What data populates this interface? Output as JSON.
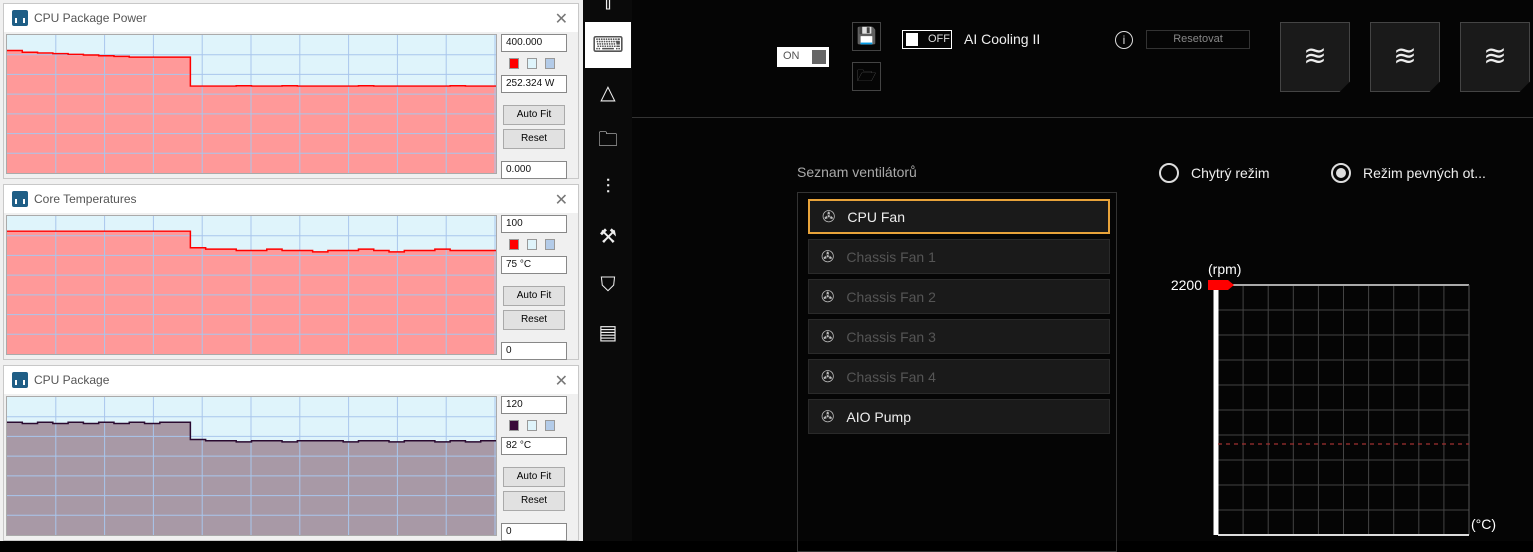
{
  "monitors": [
    {
      "title": "CPU Package Power",
      "max": "400.000",
      "current": "252.324 W",
      "min": "0.000",
      "auto_fit": "Auto Fit",
      "reset": "Reset",
      "line_color": "#ff0000",
      "fill_color": "#ff9999",
      "swatch": "#ff0000",
      "scale_max": 400,
      "values": [
        355,
        350,
        348,
        346,
        344,
        342,
        340,
        338,
        336,
        336,
        336,
        336,
        252,
        252,
        252,
        253,
        252,
        252,
        253,
        252,
        252,
        252,
        252,
        253,
        252,
        252,
        252,
        252,
        252,
        253,
        252,
        252
      ]
    },
    {
      "title": "Core Temperatures",
      "max": "100",
      "current": "75 °C",
      "min": "0",
      "auto_fit": "Auto Fit",
      "reset": "Reset",
      "line_color": "#ff0000",
      "fill_color": "#ff9999",
      "swatch": "#ff0000",
      "scale_max": 100,
      "values": [
        89,
        89,
        89,
        89,
        89,
        89,
        89,
        89,
        89,
        89,
        89,
        89,
        77,
        76,
        76,
        75,
        75,
        76,
        75,
        75,
        74,
        75,
        75,
        76,
        75,
        74,
        75,
        75,
        76,
        75,
        75,
        75
      ]
    },
    {
      "title": "CPU Package",
      "max": "120",
      "current": "82 °C",
      "min": "0",
      "auto_fit": "Auto Fit",
      "reset": "Reset",
      "line_color": "#2a0a30",
      "fill_color": "#a899a6",
      "swatch": "#3a0a3a",
      "scale_max": 120,
      "values": [
        98,
        97,
        98,
        97,
        98,
        97,
        98,
        97,
        98,
        97,
        98,
        98,
        83,
        82,
        82,
        81,
        82,
        82,
        81,
        82,
        82,
        82,
        81,
        82,
        82,
        81,
        82,
        82,
        81,
        82,
        81,
        82
      ]
    }
  ],
  "sidebar": {
    "items": [
      "keyboard-mouse-icon",
      "aura-icon",
      "game-folder-icon",
      "equalizer-icon",
      "tools-icon",
      "tag-icon",
      "news-icon"
    ]
  },
  "top": {
    "on_label": "ON",
    "off_label": "OFF",
    "ai_cooling": "AI Cooling II",
    "reset_label": "Resetovat"
  },
  "fan_list": {
    "title": "Seznam ventilátorů",
    "items": [
      {
        "label": "CPU Fan",
        "selected": true,
        "enabled": true
      },
      {
        "label": "Chassis Fan 1",
        "enabled": false
      },
      {
        "label": "Chassis Fan 2",
        "enabled": false
      },
      {
        "label": "Chassis Fan 3",
        "enabled": false
      },
      {
        "label": "Chassis Fan 4",
        "enabled": false
      },
      {
        "label": "AIO Pump",
        "enabled": true
      }
    ]
  },
  "modes": {
    "smart": "Chytrý režim",
    "fixed": "Režim pevných ot...",
    "selected": "fixed"
  },
  "chart_data": {
    "type": "line",
    "ylabel": "(rpm)",
    "xlabel": "(°C)",
    "y_max_label": "2200",
    "ymax": 2200,
    "grid_cols": 10,
    "grid_rows": 10,
    "marker_color": "#ff0000",
    "dashed_line_fraction": 0.364
  }
}
